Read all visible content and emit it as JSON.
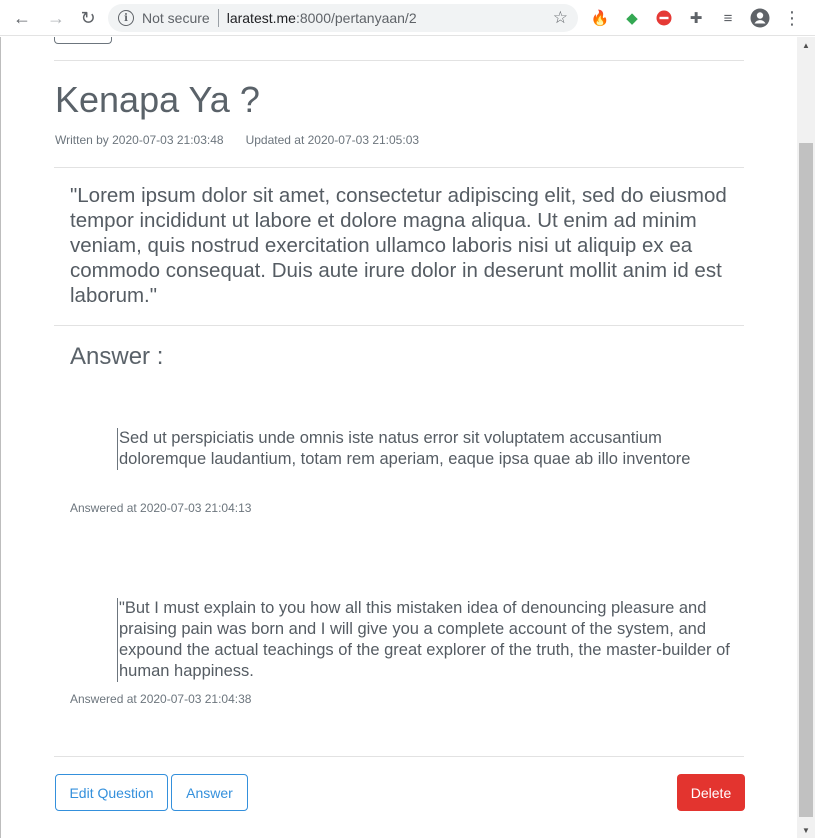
{
  "browser": {
    "security_label": "Not secure",
    "url_host": "laratest.me",
    "url_path": ":8000/pertanyaan/2"
  },
  "question": {
    "title": "Kenapa Ya ?",
    "written_by": "Written by 2020-07-03 21:03:48",
    "updated_at": "Updated at 2020-07-03 21:05:03",
    "body": "\"Lorem ipsum dolor sit amet, consectetur adipiscing elit, sed do eiusmod tempor incididunt ut labore et dolore magna aliqua. Ut enim ad minim veniam, quis nostrud exercitation ullamco laboris nisi ut aliquip ex ea commodo consequat. Duis aute irure dolor in deserunt mollit anim id est laborum.\""
  },
  "answers": {
    "heading": "Answer :",
    "items": [
      {
        "text": "Sed ut perspiciatis unde omnis iste natus error sit voluptatem accusantium doloremque laudantium, totam rem aperiam, eaque ipsa quae ab illo inventore",
        "answered_at": "Answered at 2020-07-03 21:04:13"
      },
      {
        "text": "\"But I must explain to you how all this mistaken idea of denouncing pleasure and praising pain was born and I will give you a complete account of the system, and expound the actual teachings of the great explorer of the truth, the master-builder of human happiness.",
        "answered_at": "Answered at 2020-07-03 21:04:38"
      }
    ]
  },
  "actions": {
    "edit_label": "Edit Question",
    "answer_label": "Answer",
    "delete_label": "Delete"
  },
  "colors": {
    "primary": "#3490dc",
    "danger": "#e3342f",
    "text": "#555c63"
  }
}
